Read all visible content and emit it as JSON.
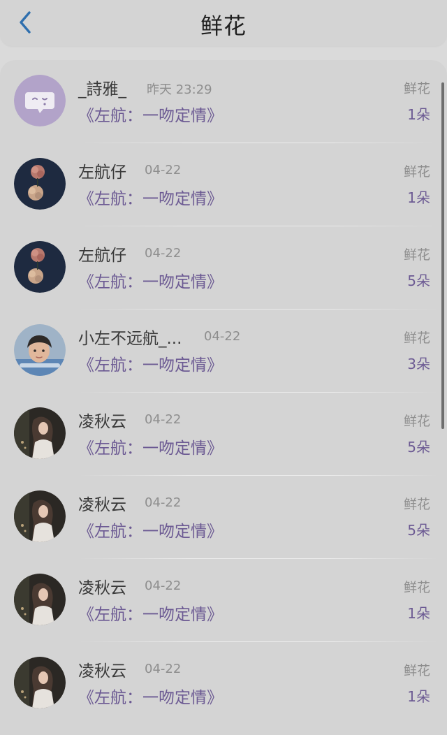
{
  "header": {
    "title": "鲜花",
    "back_icon": "chevron-left-icon",
    "accent_color": "#2f6fae"
  },
  "colors": {
    "purple": "#6c5a93",
    "gray": "#8e8e8e"
  },
  "records": [
    {
      "user": "_詩雅_",
      "time": "昨天 23:29",
      "book": "《左航：一吻定情》",
      "gift": "鲜花",
      "count": "1朵",
      "avatar": "chat-bubble-icon"
    },
    {
      "user": "左航仔",
      "time": "04-22",
      "book": "《左航：一吻定情》",
      "gift": "鲜花",
      "count": "1朵",
      "avatar": "flower-photo-avatar"
    },
    {
      "user": "左航仔",
      "time": "04-22",
      "book": "《左航：一吻定情》",
      "gift": "鲜花",
      "count": "5朵",
      "avatar": "flower-photo-avatar"
    },
    {
      "user": "小左不远航_...",
      "time": "04-22",
      "book": "《左航：一吻定情》",
      "gift": "鲜花",
      "count": "3朵",
      "avatar": "boy-photo-avatar"
    },
    {
      "user": "凌秋云",
      "time": "04-22",
      "book": "《左航：一吻定情》",
      "gift": "鲜花",
      "count": "5朵",
      "avatar": "girl-photo-avatar"
    },
    {
      "user": "凌秋云",
      "time": "04-22",
      "book": "《左航：一吻定情》",
      "gift": "鲜花",
      "count": "5朵",
      "avatar": "girl-photo-avatar"
    },
    {
      "user": "凌秋云",
      "time": "04-22",
      "book": "《左航：一吻定情》",
      "gift": "鲜花",
      "count": "1朵",
      "avatar": "girl-photo-avatar"
    },
    {
      "user": "凌秋云",
      "time": "04-22",
      "book": "《左航：一吻定情》",
      "gift": "鲜花",
      "count": "1朵",
      "avatar": "girl-photo-avatar"
    }
  ]
}
